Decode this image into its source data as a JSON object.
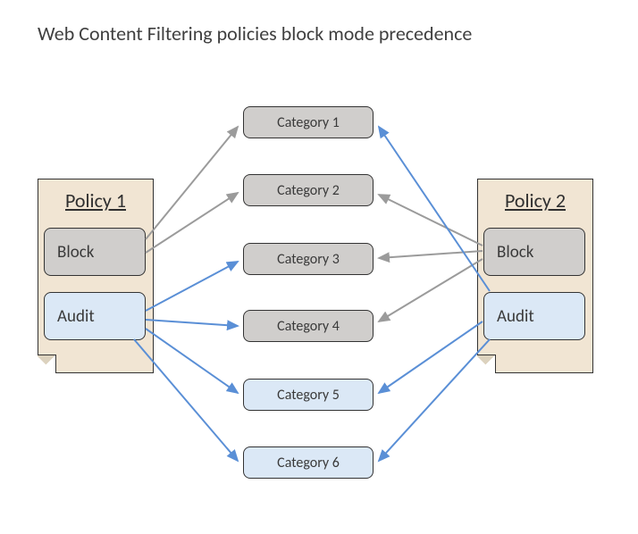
{
  "title": "Web Content Filtering policies block mode precedence",
  "policy1": {
    "title": "Policy 1",
    "block": "Block",
    "audit": "Audit"
  },
  "policy2": {
    "title": "Policy 2",
    "block": "Block",
    "audit": "Audit"
  },
  "categories": {
    "c1": "Category  1",
    "c2": "Category  2",
    "c3": "Category  3",
    "c4": "Category  4",
    "c5": "Category  5",
    "c6": "Category  6"
  },
  "arrows": {
    "grayColor": "#9b9b9b",
    "blueColor": "#5a8fd6"
  },
  "connections": {
    "policy1_block_to": [
      "c1",
      "c2"
    ],
    "policy1_audit_to": [
      "c3",
      "c4",
      "c5",
      "c6"
    ],
    "policy2_block_to": [
      "c2",
      "c3",
      "c4"
    ],
    "policy2_audit_to": [
      "c1",
      "c5",
      "c6"
    ]
  }
}
